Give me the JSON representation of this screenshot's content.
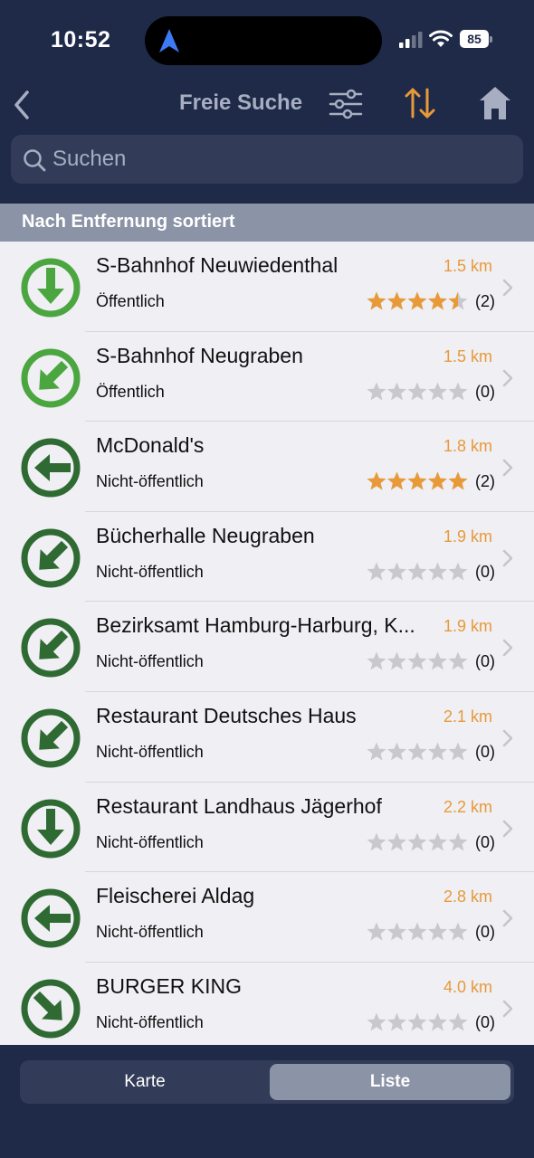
{
  "status_bar": {
    "time": "10:52",
    "battery": "85"
  },
  "nav": {
    "title": "Freie Suche",
    "back_icon": "chevron-left-icon",
    "filter_icon": "sliders-icon",
    "sort_icon": "sort-arrows-icon",
    "home_icon": "home-icon"
  },
  "search": {
    "placeholder": "Suchen",
    "value": ""
  },
  "section": {
    "title": "Nach Entfernung sortiert"
  },
  "colors": {
    "background": "#1e2a48",
    "accent": "#e89a39",
    "green_light": "#4ba640",
    "green_dark": "#2e6a32",
    "section": "#8b93a6"
  },
  "items": [
    {
      "name": "S-Bahnhof Neuwiedenthal",
      "distance": "1.5 km",
      "access": "Öffentlich",
      "rating": 4.5,
      "count": "(2)",
      "direction": "south",
      "public": true
    },
    {
      "name": "S-Bahnhof Neugraben",
      "distance": "1.5 km",
      "access": "Öffentlich",
      "rating": 0,
      "count": "(0)",
      "direction": "southwest",
      "public": true
    },
    {
      "name": "McDonald's",
      "distance": "1.8 km",
      "access": "Nicht-öffentlich",
      "rating": 5,
      "count": "(2)",
      "direction": "west",
      "public": false
    },
    {
      "name": "Bücherhalle Neugraben",
      "distance": "1.9 km",
      "access": "Nicht-öffentlich",
      "rating": 0,
      "count": "(0)",
      "direction": "southwest",
      "public": false
    },
    {
      "name": "Bezirksamt Hamburg-Harburg, K...",
      "distance": "1.9 km",
      "access": "Nicht-öffentlich",
      "rating": 0,
      "count": "(0)",
      "direction": "southwest",
      "public": false
    },
    {
      "name": "Restaurant Deutsches Haus",
      "distance": "2.1 km",
      "access": "Nicht-öffentlich",
      "rating": 0,
      "count": "(0)",
      "direction": "southwest",
      "public": false
    },
    {
      "name": "Restaurant Landhaus Jägerhof",
      "distance": "2.2 km",
      "access": "Nicht-öffentlich",
      "rating": 0,
      "count": "(0)",
      "direction": "south",
      "public": false
    },
    {
      "name": "Fleischerei Aldag",
      "distance": "2.8 km",
      "access": "Nicht-öffentlich",
      "rating": 0,
      "count": "(0)",
      "direction": "west",
      "public": false
    },
    {
      "name": "BURGER KING",
      "distance": "4.0 km",
      "access": "Nicht-öffentlich",
      "rating": 0,
      "count": "(0)",
      "direction": "southeast",
      "public": false
    }
  ],
  "tabs": {
    "map": "Karte",
    "list": "Liste",
    "selected": "list"
  }
}
